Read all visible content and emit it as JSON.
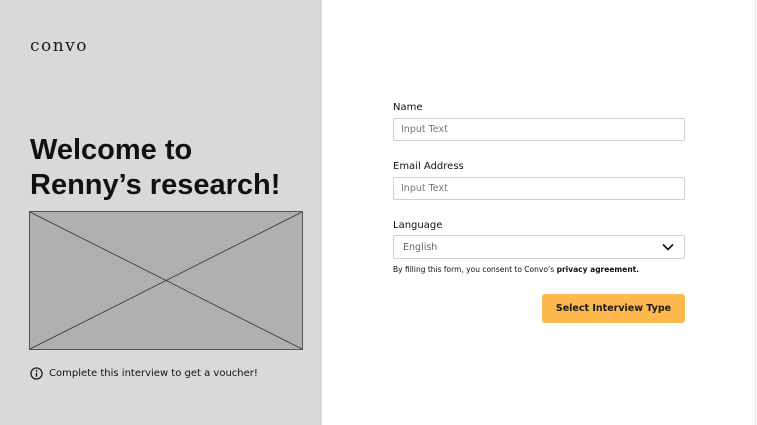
{
  "brand": {
    "logo_text": "convo"
  },
  "hero": {
    "headline_line1": "Welcome to",
    "headline_line2": "Renny’s research!",
    "voucher_note": "Complete this interview to get a voucher!"
  },
  "form": {
    "name": {
      "label": "Name",
      "placeholder": "Input Text",
      "value": ""
    },
    "email": {
      "label": "Email Address",
      "placeholder": "Input Text",
      "value": ""
    },
    "language": {
      "label": "Language",
      "selected": "English"
    },
    "consent_prefix": "By filling this form, you consent to Convo’s ",
    "consent_link": "privacy agreement.",
    "submit_label": "Select Interview Type"
  },
  "colors": {
    "left_panel_bg": "#d9d9d9",
    "image_placeholder_bg": "#b0b0b0",
    "button_accent": "#fdb84e"
  },
  "icons": {
    "info": "info-circle-icon",
    "dropdown": "chevron-down-icon"
  }
}
